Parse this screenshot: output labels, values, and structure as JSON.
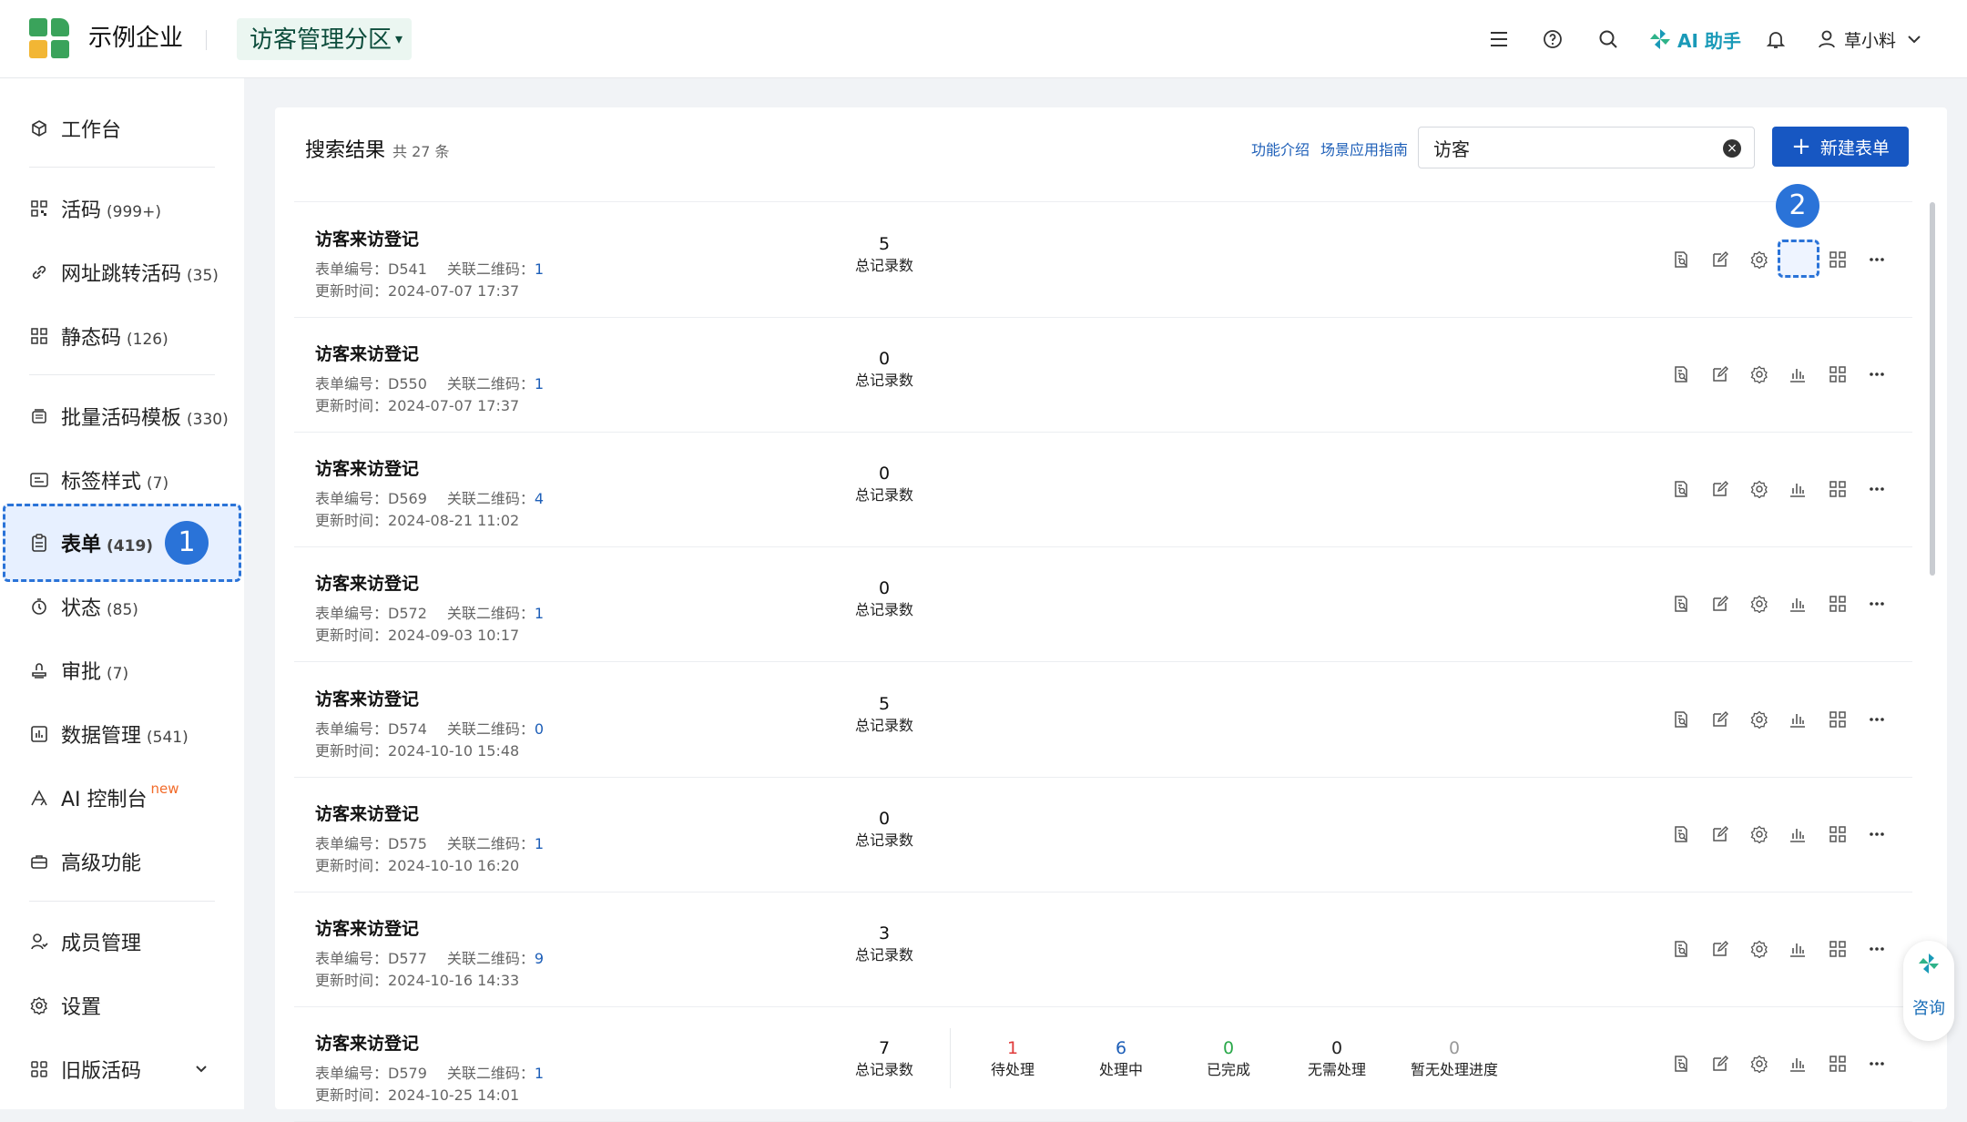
{
  "header": {
    "company": "示例企业",
    "zone": "访客管理分区",
    "ai_label": "AI 助手",
    "user_name": "草小料"
  },
  "sidebar": {
    "items": [
      {
        "label": "工作台",
        "count": ""
      },
      {
        "label": "活码",
        "count": "(999+)"
      },
      {
        "label": "网址跳转活码",
        "count": "(35)"
      },
      {
        "label": "静态码",
        "count": "(126)"
      },
      {
        "label": "批量活码模板",
        "count": "(330)"
      },
      {
        "label": "标签样式",
        "count": "(7)"
      },
      {
        "label": "表单",
        "count": "(419)"
      },
      {
        "label": "状态",
        "count": "(85)"
      },
      {
        "label": "审批",
        "count": "(7)"
      },
      {
        "label": "数据管理",
        "count": "(541)"
      },
      {
        "label": "AI 控制台",
        "count": "",
        "tag": "new"
      },
      {
        "label": "高级功能",
        "count": ""
      },
      {
        "label": "成员管理",
        "count": ""
      },
      {
        "label": "设置",
        "count": ""
      },
      {
        "label": "旧版活码",
        "count": ""
      }
    ]
  },
  "markers": {
    "one": "1",
    "two": "2"
  },
  "main": {
    "title": "搜索结果",
    "count_text": "共 27 条",
    "link_intro": "功能介绍",
    "link_guide": "场景应用指南",
    "search_value": "访客",
    "new_button": "新建表单",
    "code_label": "表单编号：",
    "qr_label": "关联二维码：",
    "time_label": "更新时间：",
    "total_label": "总记录数",
    "rows": [
      {
        "title": "访客来访登记",
        "code": "D541",
        "qr": "1",
        "time": "2024-07-07 17:37",
        "total": "5"
      },
      {
        "title": "访客来访登记",
        "code": "D550",
        "qr": "1",
        "time": "2024-07-07 17:37",
        "total": "0"
      },
      {
        "title": "访客来访登记",
        "code": "D569",
        "qr": "4",
        "time": "2024-08-21 11:02",
        "total": "0"
      },
      {
        "title": "访客来访登记",
        "code": "D572",
        "qr": "1",
        "time": "2024-09-03 10:17",
        "total": "0"
      },
      {
        "title": "访客来访登记",
        "code": "D574",
        "qr": "0",
        "time": "2024-10-10 15:48",
        "total": "5"
      },
      {
        "title": "访客来访登记",
        "code": "D575",
        "qr": "1",
        "time": "2024-10-10 16:20",
        "total": "0"
      },
      {
        "title": "访客来访登记",
        "code": "D577",
        "qr": "9",
        "time": "2024-10-16 14:33",
        "total": "3"
      },
      {
        "title": "访客来访登记",
        "code": "D579",
        "qr": "1",
        "time": "2024-10-25 14:01",
        "total": "7"
      }
    ],
    "last_row_stats": [
      {
        "value": "1",
        "label": "待处理",
        "color": "#e03a3a"
      },
      {
        "value": "6",
        "label": "处理中",
        "color": "#1e5fb8"
      },
      {
        "value": "0",
        "label": "已完成",
        "color": "#2aa84a"
      },
      {
        "value": "0",
        "label": "无需处理",
        "color": "#222222"
      },
      {
        "value": "0",
        "label": "暂无处理进度",
        "color": "#999999"
      }
    ]
  },
  "consult_label": "咨询",
  "colors": {
    "brand_blue": "#1757c2",
    "accent_green": "#3aa35b",
    "link": "#1e5fb8"
  }
}
